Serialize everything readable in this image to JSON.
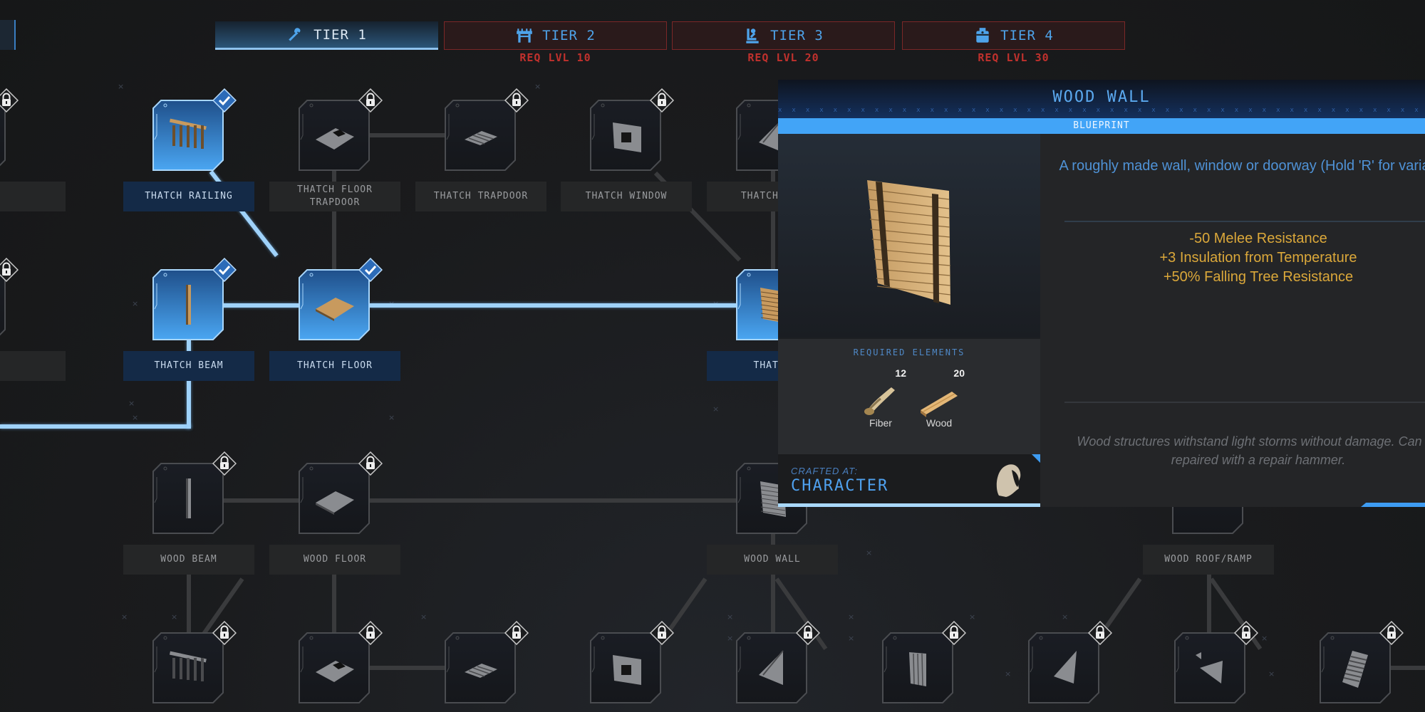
{
  "tiers": [
    {
      "label": "TIER 1",
      "icon": "hammer-icon",
      "state": "active",
      "requirement": ""
    },
    {
      "label": "TIER 2",
      "icon": "table-icon",
      "state": "locked",
      "requirement": "REQ LVL 10"
    },
    {
      "label": "TIER 3",
      "icon": "workbench-arm-icon",
      "state": "locked",
      "requirement": "REQ LVL 20"
    },
    {
      "label": "TIER 4",
      "icon": "furnace-icon",
      "state": "locked",
      "requirement": "REQ LVL 30"
    }
  ],
  "nodes": [
    {
      "id": "left-r1",
      "label": "",
      "state": "locked"
    },
    {
      "id": "thatch-railing",
      "label": "THATCH RAILING",
      "state": "unlocked"
    },
    {
      "id": "thatch-floor-trapdoor",
      "label": "THATCH FLOOR TRAPDOOR",
      "state": "locked"
    },
    {
      "id": "thatch-trapdoor",
      "label": "THATCH TRAPDOOR",
      "state": "locked"
    },
    {
      "id": "thatch-window",
      "label": "THATCH WINDOW",
      "state": "locked"
    },
    {
      "id": "thatch-wall-top",
      "label": "THATCH WAL",
      "state": "locked"
    },
    {
      "id": "left-r2",
      "label": "",
      "state": "locked"
    },
    {
      "id": "thatch-beam",
      "label": "THATCH BEAM",
      "state": "unlocked"
    },
    {
      "id": "thatch-floor",
      "label": "THATCH FLOOR",
      "state": "unlocked"
    },
    {
      "id": "thatch-wall",
      "label": "THATCH",
      "state": "unlocked"
    },
    {
      "id": "wood-beam",
      "label": "WOOD BEAM",
      "state": "locked"
    },
    {
      "id": "wood-floor",
      "label": "WOOD FLOOR",
      "state": "locked"
    },
    {
      "id": "wood-wall",
      "label": "WOOD WALL",
      "state": "locked"
    },
    {
      "id": "wood-roof-ramp",
      "label": "WOOD ROOF/RAMP",
      "state": "locked"
    },
    {
      "id": "wood-railing",
      "label": "",
      "state": "locked"
    },
    {
      "id": "wood-floor-trapdoor",
      "label": "",
      "state": "locked"
    },
    {
      "id": "wood-trapdoor",
      "label": "",
      "state": "locked"
    },
    {
      "id": "wood-window",
      "label": "",
      "state": "locked"
    },
    {
      "id": "wood-wedge-a",
      "label": "",
      "state": "locked"
    },
    {
      "id": "wood-door",
      "label": "",
      "state": "locked"
    },
    {
      "id": "wood-wedge-b",
      "label": "",
      "state": "locked"
    },
    {
      "id": "wood-roof-variant",
      "label": "",
      "state": "locked"
    },
    {
      "id": "wood-stairs",
      "label": "",
      "state": "locked"
    }
  ],
  "tooltip": {
    "title": "WOOD WALL",
    "subtitle": "BLUEPRINT",
    "description": "A roughly made wall, window or doorway (Hold 'R' for variants).",
    "stats": [
      "-50 Melee Resistance",
      "+3 Insulation from Temperature",
      "+50% Falling Tree Resistance"
    ],
    "flavor": "Wood structures withstand light storms without damage. Can be repaired with a repair hammer.",
    "required_title": "REQUIRED ELEMENTS",
    "resources": [
      {
        "name": "Fiber",
        "qty": "12",
        "icon": "fiber-icon"
      },
      {
        "name": "Wood",
        "qty": "20",
        "icon": "wood-plank-icon"
      }
    ],
    "crafted_at_label": "CRAFTED AT:",
    "crafted_at_value": "CHARACTER"
  },
  "colors": {
    "accent_blue": "#42a4f7",
    "locked_red": "#c0312d",
    "stat_gold": "#dba83a"
  }
}
